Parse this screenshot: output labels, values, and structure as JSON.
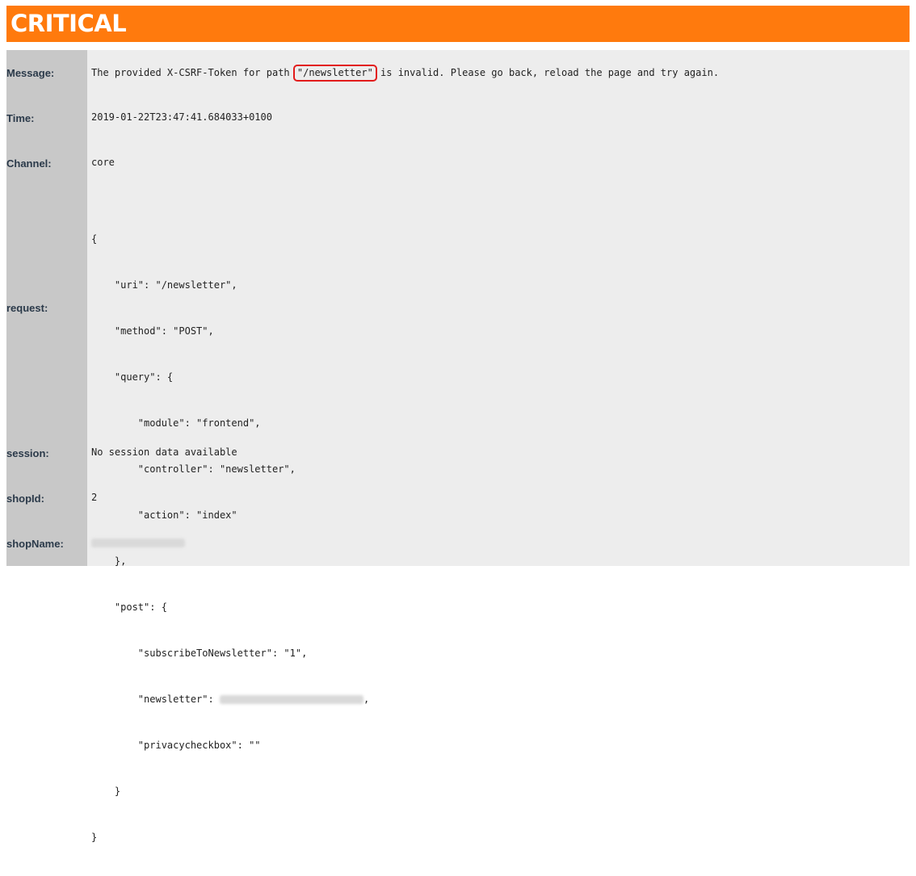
{
  "header": {
    "title": "CRITICAL",
    "color": "#ff7a0d"
  },
  "rows": {
    "message": {
      "label": "Message:",
      "text_before": "The provided X-CSRF-Token for path ",
      "highlight": "\"/newsletter\"",
      "text_after": " is invalid. Please go back, reload the page and try again."
    },
    "time": {
      "label": "Time:",
      "value": "2019-01-22T23:47:41.684033+0100"
    },
    "channel": {
      "label": "Channel:",
      "value": "core"
    },
    "request": {
      "label": "request:",
      "lines": [
        "{",
        "    \"uri\": \"/newsletter\",",
        "    \"method\": \"POST\",",
        "    \"query\": {",
        "        \"module\": \"frontend\",",
        "        \"controller\": \"newsletter\",",
        "        \"action\": \"index\"",
        "    },",
        "    \"post\": {",
        "        \"subscribeToNewsletter\": \"1\",",
        "        \"newsletter\": ",
        ",",
        "        \"privacycheckbox\": \"\"",
        "    }",
        "}"
      ]
    },
    "session": {
      "label": "session:",
      "value": "No session data available"
    },
    "shopid": {
      "label": "shopId:",
      "value": "2"
    },
    "shopname": {
      "label": "shopName:"
    }
  },
  "colors": {
    "label_column": "#c8c8c8",
    "value_background": "#ededed",
    "highlight_border": "#e21b1b"
  }
}
